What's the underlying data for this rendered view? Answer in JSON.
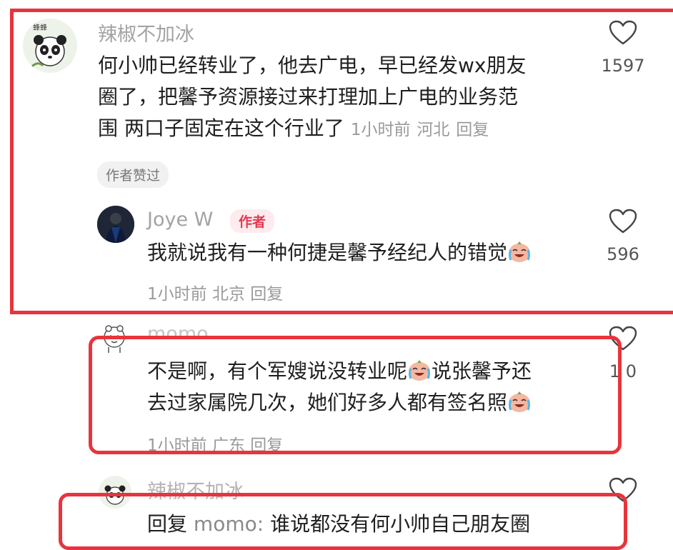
{
  "comments": [
    {
      "username": "辣椒不加冰",
      "text_lines": [
        "何小帅已经转业了，他去广电，早已经发wx朋友",
        "圈了，把馨予资源接过来打理加上广电的业务范",
        "围 两口子固定在这个行业了"
      ],
      "time": "1小时前",
      "location": "河北",
      "reply_label": "回复",
      "likes": "1597",
      "badge": "作者赞过"
    },
    {
      "username": "Joye W",
      "author_tag": "作者",
      "text": "我就说我有一种何捷是馨予经纪人的错觉",
      "time": "1小时前",
      "location": "北京",
      "reply_label": "回复",
      "likes": "596"
    },
    {
      "username": "momo",
      "text_lines": [
        "不是啊，有个军嫂说没转业呢",
        "说张馨予还",
        "去过家属院几次，她们好多人都有签名照"
      ],
      "time": "1小时前",
      "location": "广东",
      "reply_label": "回复",
      "likes": "1 0"
    },
    {
      "username": "辣椒不加冰",
      "reply_prefix": "回复",
      "reply_to": "momo:",
      "text": "谁说都没有何小帅自己朋友圈"
    }
  ],
  "icons": {
    "heart": "heart-icon",
    "emoji": "crying-laughing-emoji-icon"
  },
  "colors": {
    "highlight_red": "#e8343c",
    "author_red": "#e5384f",
    "meta_gray": "#9a9a9a"
  }
}
